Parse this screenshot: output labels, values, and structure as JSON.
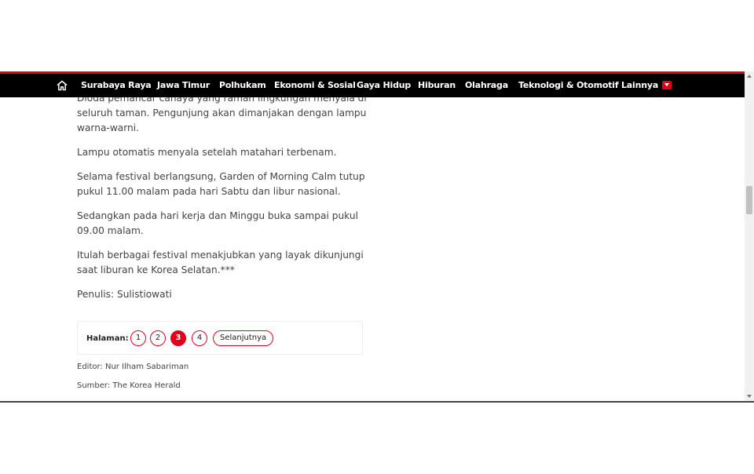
{
  "nav": {
    "items": [
      {
        "label": "Surabaya Raya"
      },
      {
        "label": "Jawa Timur"
      },
      {
        "label": "Polhukam"
      },
      {
        "label": "Ekonomi & Sosial"
      },
      {
        "label": "Gaya Hidup"
      },
      {
        "label": "Hiburan"
      },
      {
        "label": "Olahraga"
      },
      {
        "label": "Teknologi & Otomotif"
      }
    ],
    "more_label": "Lainnya",
    "home_icon": "home-icon",
    "more_icon": "caret-down-icon"
  },
  "article": {
    "paragraphs": [
      "Dioda pemancar cahaya yang ramah lingkungan menyala di seluruh taman. Pengunjung akan dimanjakan dengan lampu warna-warni.",
      "Lampu otomatis menyala setelah matahari terbenam.",
      "Selama festival berlangsung, Garden of Morning Calm tutup pukul 11.00 malam pada hari Sabtu dan libur nasional.",
      "Sedangkan pada hari kerja dan Minggu buka sampai pukul 09.00 malam.",
      "Itulah berbagai festival menakjubkan yang layak dikunjungi saat liburan ke Korea Selatan.***",
      "Penulis: Sulistiowati"
    ]
  },
  "pagination": {
    "label": "Halaman:",
    "pages": [
      "1",
      "2",
      "3",
      "4"
    ],
    "current": "3",
    "next_label": "Selanjutnya"
  },
  "meta": {
    "editor": "Editor: Nur Ilham Sabariman",
    "source": "Sumber: The Korea Herald"
  },
  "colors": {
    "accent": "#e4001b",
    "navbar": "#000000"
  }
}
